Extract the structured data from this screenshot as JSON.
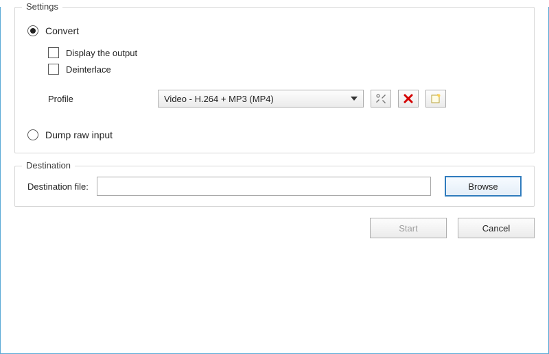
{
  "settings": {
    "legend": "Settings",
    "convert": {
      "label": "Convert",
      "selected": true,
      "display_output": {
        "label": "Display the output",
        "checked": false
      },
      "deinterlace": {
        "label": "Deinterlace",
        "checked": false
      },
      "profile": {
        "label": "Profile",
        "selectedValue": "Video - H.264 + MP3 (MP4)"
      }
    },
    "dump": {
      "label": "Dump raw input",
      "selected": false
    }
  },
  "destination": {
    "legend": "Destination",
    "file_label": "Destination file:",
    "file_value": "",
    "browse_label": "Browse"
  },
  "footer": {
    "start_label": "Start",
    "start_enabled": false,
    "cancel_label": "Cancel"
  },
  "icons": {
    "tools": "tools-icon",
    "delete": "delete-icon",
    "new": "new-profile-icon"
  }
}
